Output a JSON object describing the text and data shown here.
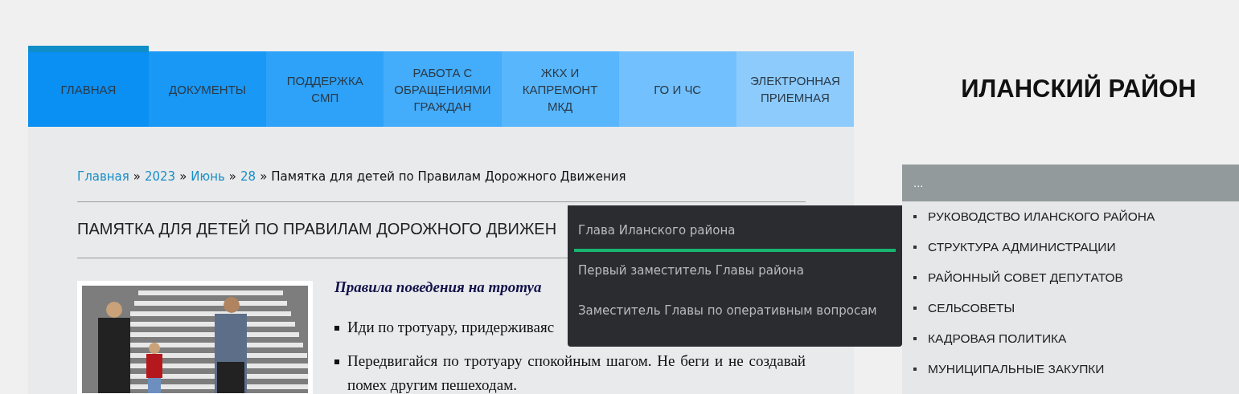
{
  "nav": [
    {
      "label": "ГЛАВНАЯ",
      "selected": true
    },
    {
      "label": "ДОКУМЕНТЫ",
      "selected": false
    },
    {
      "label": "ПОДДЕРЖКА СМП",
      "selected": false
    },
    {
      "label": "РАБОТА С ОБРАЩЕНИЯМИ ГРАЖДАН",
      "selected": false
    },
    {
      "label": "ЖКХ И КАПРЕМОНТ МКД",
      "selected": false
    },
    {
      "label": "ГО И ЧС",
      "selected": false
    },
    {
      "label": "ЭЛЕКТРОННАЯ ПРИЕМНАЯ",
      "selected": false
    }
  ],
  "breadcrumbs": {
    "links": [
      "Главная",
      "2023",
      "Июнь",
      "28"
    ],
    "separator": "»",
    "current": "Памятка для детей по Правилам Дорожного Движения"
  },
  "article": {
    "title": "ПАМЯТКА ДЛЯ ДЕТЕЙ ПО ПРАВИЛАМ ДОРОЖНОГО ДВИЖЕН",
    "image": {
      "kind": "picture"
    },
    "subtitle": "Правила поведения на тротуа",
    "bullets": [
      "Иди по тротуару, придерживаяс",
      "Передвигайся по тротуару спокойным шагом. Не беги и не создавай помех другим пешеходам."
    ]
  },
  "site_title": "ИЛАНСКИЙ РАЙОН",
  "sidebar": {
    "header": "...",
    "items": [
      "РУКОВОДСТВО ИЛАНСКОГО РАЙОНА",
      "СТРУКТУРА АДМИНИСТРАЦИИ",
      "РАЙОННЫЙ СОВЕТ ДЕПУТАТОВ",
      "СЕЛЬСОВЕТЫ",
      "КАДРОВАЯ ПОЛИТИКА",
      "МУНИЦИПАЛЬНЫЕ ЗАКУПКИ"
    ]
  },
  "dropdown": [
    {
      "label": "Глава Иланского района",
      "selected": true
    },
    {
      "label": "Первый заместитель Главы района",
      "selected": false
    },
    {
      "label": "Заместитель Главы по оперативным вопросам",
      "selected": false
    }
  ]
}
